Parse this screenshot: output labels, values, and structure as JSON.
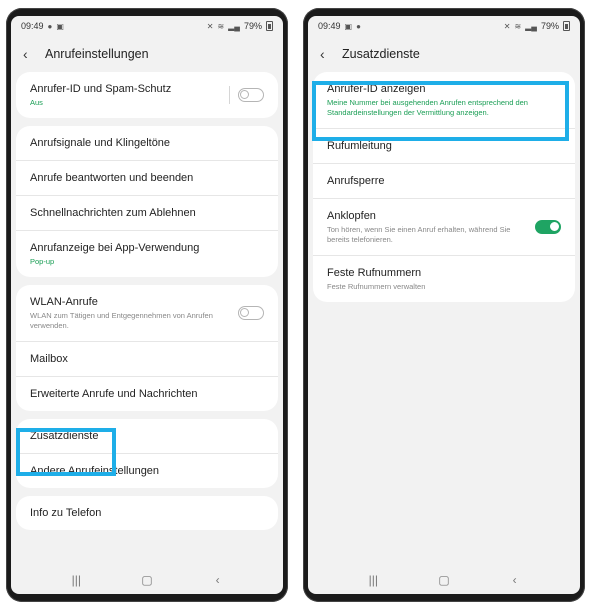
{
  "left": {
    "status": {
      "time": "09:49",
      "battery": "79%"
    },
    "header": {
      "title": "Anrufeinstellungen"
    },
    "groups": [
      {
        "items": [
          {
            "title": "Anrufer-ID und Spam-Schutz",
            "subtitle": "Aus",
            "toggle": "off"
          }
        ]
      },
      {
        "items": [
          {
            "title": "Anrufsignale und Klingeltöne"
          },
          {
            "title": "Anrufe beantworten und beenden"
          },
          {
            "title": "Schnellnachrichten zum Ablehnen"
          },
          {
            "title": "Anrufanzeige bei App-Verwendung",
            "subtitle": "Pop-up"
          }
        ]
      },
      {
        "items": [
          {
            "title": "WLAN-Anrufe",
            "subtitle": "WLAN zum Tätigen und Entgegennehmen von Anrufen verwenden.",
            "toggle": "off"
          },
          {
            "title": "Mailbox"
          },
          {
            "title": "Erweiterte Anrufe und Nachrichten"
          }
        ]
      },
      {
        "items": [
          {
            "title": "Zusatzdienste"
          },
          {
            "title": "Andere Anrufeinstellungen"
          }
        ]
      },
      {
        "items": [
          {
            "title": "Info zu Telefon"
          }
        ]
      }
    ]
  },
  "right": {
    "status": {
      "time": "09:49",
      "battery": "79%"
    },
    "header": {
      "title": "Zusatzdienste"
    },
    "items": [
      {
        "title": "Anrufer-ID anzeigen",
        "subtitle": "Meine Nummer bei ausgehenden Anrufen entsprechend den Standardeinstellungen der Vermittlung anzeigen."
      },
      {
        "title": "Rufumleitung"
      },
      {
        "title": "Anrufsperre"
      },
      {
        "title": "Anklopfen",
        "subtitle": "Ton hören, wenn Sie einen Anruf erhalten, während Sie bereits telefonieren.",
        "toggle": "on"
      },
      {
        "title": "Feste Rufnummern",
        "subtitle": "Feste Rufnummern verwalten"
      }
    ]
  },
  "icons": {
    "back": "chevron-left-icon",
    "recents": "recent-apps-icon",
    "home": "home-icon",
    "nav_back": "nav-back-icon"
  },
  "colors": {
    "highlight": "#1eaee8",
    "toggle_on": "#1fa463",
    "subtitle_green": "#1a9e55",
    "background": "#f2f2f2"
  }
}
